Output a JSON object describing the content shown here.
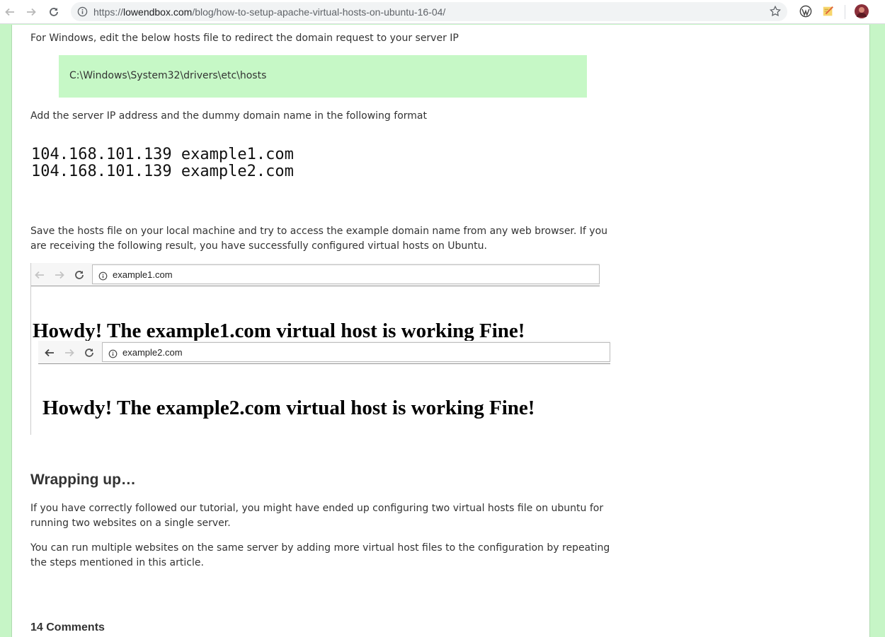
{
  "browser": {
    "url_prefix": "https://",
    "url_host": "lowendbox.com",
    "url_path": "/blog/how-to-setup-apache-virtual-hosts-on-ubuntu-16-04/",
    "icons": [
      "back-icon",
      "forward-icon",
      "reload-icon",
      "info-icon",
      "star-icon",
      "wordpress-icon",
      "notes-extension-icon",
      "profile-avatar"
    ]
  },
  "article": {
    "windows_intro": "For Windows, edit the below hosts file to redirect the domain request to your server IP",
    "hosts_path": "C:\\Windows\\System32\\drivers\\etc\\hosts",
    "format_intro": "Add the server IP address and the dummy domain name in the following format",
    "hosts_lines": [
      "104.168.101.139 example1.com",
      "104.168.101.139 example2.com"
    ],
    "save_paragraph": "Save the hosts file on your local machine and try to access the example domain name from any web browser. If you are receiving the following result, you have successfully configured virtual hosts on Ubuntu.",
    "screenshot": {
      "site1_url": "example1.com",
      "site1_heading": "Howdy! The example1.com virtual host is working Fine!",
      "site2_url": "example2.com",
      "site2_heading": "Howdy! The example2.com virtual host is working Fine!"
    },
    "wrapping_heading": "Wrapping up…",
    "wrapping_p1": "If you have correctly followed our tutorial, you might have ended up configuring two virtual hosts file on ubuntu for running two websites on a single server.",
    "wrapping_p2": "You can run multiple websites on the same server by adding more virtual host files to the configuration by repeating the steps mentioned in this article.",
    "comments_heading": "14 Comments"
  },
  "colors": {
    "page_background": "#c6f5c6",
    "code_background": "#c6f8c6"
  }
}
